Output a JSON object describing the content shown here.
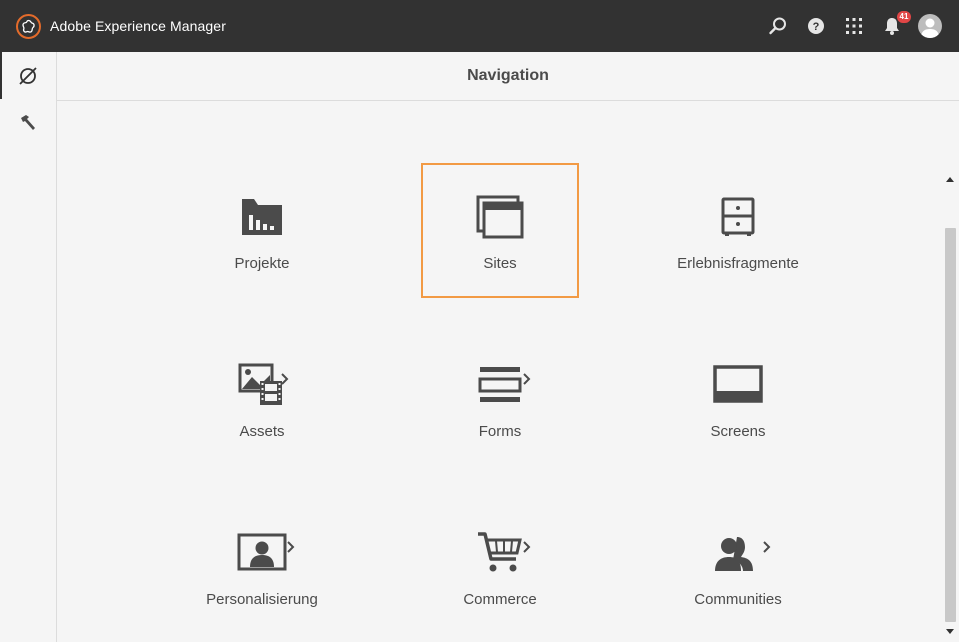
{
  "app": {
    "title": "Adobe Experience Manager",
    "logo_icon": "adobe-experience-cloud-icon",
    "accent_color": "#e36b2b"
  },
  "topbar": {
    "search_icon": "search-icon",
    "help_icon": "help-icon",
    "solutions_icon": "grid-icon",
    "notifications_icon": "bell-icon",
    "notification_count": "41",
    "avatar_icon": "user-avatar-icon"
  },
  "rail": {
    "items": [
      {
        "name": "navigation",
        "icon": "compass-icon",
        "active": true
      },
      {
        "name": "tools",
        "icon": "hammer-icon",
        "active": false
      }
    ]
  },
  "header": {
    "title": "Navigation"
  },
  "tiles": [
    {
      "id": "projekte",
      "label": "Projekte",
      "icon": "projects-folder-icon",
      "has_submenu": false,
      "selected": false
    },
    {
      "id": "sites",
      "label": "Sites",
      "icon": "sites-windows-icon",
      "has_submenu": false,
      "selected": true
    },
    {
      "id": "erlebnisfragmente",
      "label": "Erlebnisfragmente",
      "icon": "experience-fragments-cabinet-icon",
      "has_submenu": false,
      "selected": false
    },
    {
      "id": "assets",
      "label": "Assets",
      "icon": "assets-image-film-icon",
      "has_submenu": true,
      "selected": false
    },
    {
      "id": "forms",
      "label": "Forms",
      "icon": "forms-lines-icon",
      "has_submenu": true,
      "selected": false
    },
    {
      "id": "screens",
      "label": "Screens",
      "icon": "screens-monitor-icon",
      "has_submenu": false,
      "selected": false
    },
    {
      "id": "personalisierung",
      "label": "Personalisierung",
      "icon": "personalization-portrait-icon",
      "has_submenu": true,
      "selected": false
    },
    {
      "id": "commerce",
      "label": "Commerce",
      "icon": "commerce-cart-icon",
      "has_submenu": true,
      "selected": false
    },
    {
      "id": "communities",
      "label": "Communities",
      "icon": "communities-people-icon",
      "has_submenu": true,
      "selected": false
    }
  ],
  "colors": {
    "topbar": "#323232",
    "background": "#f5f5f5",
    "icon": "#4b4b4b",
    "selection": "#f29a44",
    "badge": "#e14646"
  }
}
